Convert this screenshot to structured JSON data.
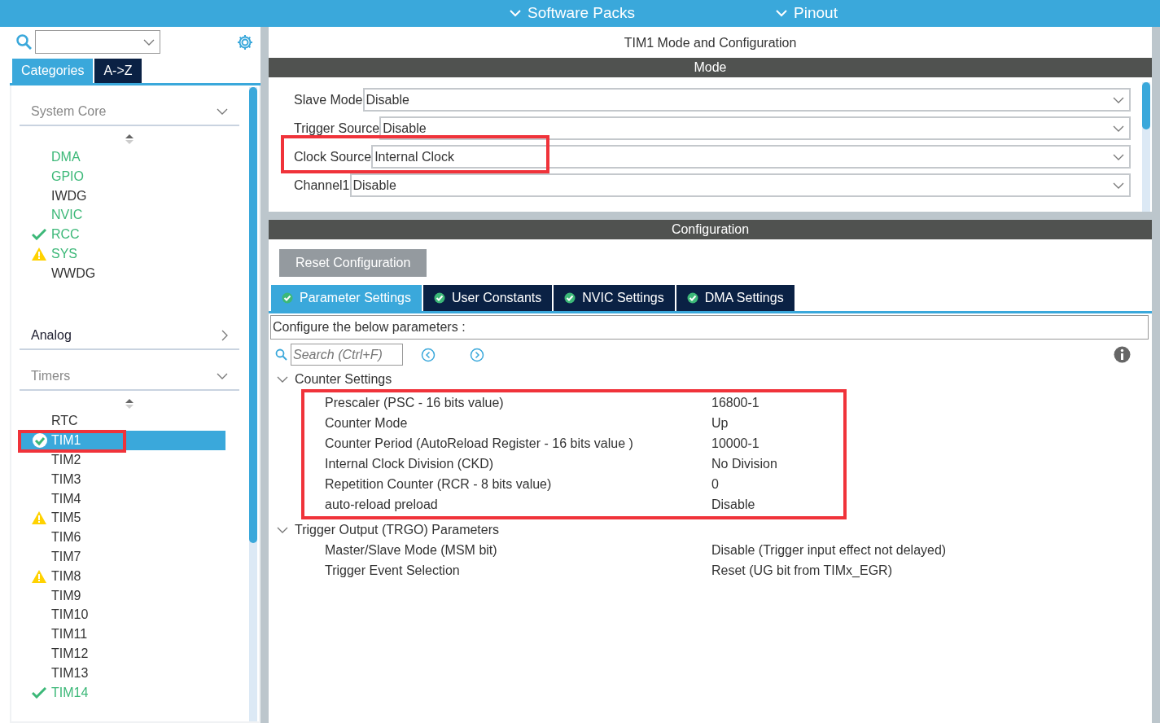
{
  "top_bar": {
    "menus": [
      {
        "label": "Software Packs"
      },
      {
        "label": "Pinout"
      }
    ]
  },
  "sidebar": {
    "tabs": [
      {
        "label": "Categories",
        "selected": true
      },
      {
        "label": "A->Z",
        "selected": false
      }
    ],
    "categories": [
      {
        "label": "System Core",
        "expanded": true,
        "items": [
          {
            "label": "DMA",
            "enabled": true,
            "kind": "plain",
            "selected": false,
            "highlighted": false
          },
          {
            "label": "GPIO",
            "enabled": true,
            "kind": "plain",
            "selected": false,
            "highlighted": false
          },
          {
            "label": "IWDG",
            "enabled": false,
            "kind": "plain",
            "selected": false,
            "highlighted": false
          },
          {
            "label": "NVIC",
            "enabled": true,
            "kind": "plain",
            "selected": false,
            "highlighted": false
          },
          {
            "label": "RCC",
            "enabled": true,
            "kind": "check",
            "selected": false,
            "highlighted": false
          },
          {
            "label": "SYS",
            "enabled": true,
            "kind": "warning",
            "selected": false,
            "highlighted": false
          },
          {
            "label": "WWDG",
            "enabled": false,
            "kind": "plain",
            "selected": false,
            "highlighted": false
          }
        ]
      },
      {
        "label": "Analog",
        "expanded": false
      },
      {
        "label": "Timers",
        "expanded": true,
        "items": [
          {
            "label": "RTC",
            "enabled": false,
            "kind": "plain",
            "selected": false,
            "highlighted": false
          },
          {
            "label": "TIM1",
            "enabled": true,
            "kind": "check",
            "selected": true,
            "highlighted": true
          },
          {
            "label": "TIM2",
            "enabled": false,
            "kind": "plain",
            "selected": false,
            "highlighted": false
          },
          {
            "label": "TIM3",
            "enabled": false,
            "kind": "plain",
            "selected": false,
            "highlighted": false
          },
          {
            "label": "TIM4",
            "enabled": false,
            "kind": "plain",
            "selected": false,
            "highlighted": false
          },
          {
            "label": "TIM5",
            "enabled": false,
            "kind": "warning",
            "selected": false,
            "highlighted": false
          },
          {
            "label": "TIM6",
            "enabled": false,
            "kind": "plain",
            "selected": false,
            "highlighted": false
          },
          {
            "label": "TIM7",
            "enabled": false,
            "kind": "plain",
            "selected": false,
            "highlighted": false
          },
          {
            "label": "TIM8",
            "enabled": false,
            "kind": "warning",
            "selected": false,
            "highlighted": false
          },
          {
            "label": "TIM9",
            "enabled": false,
            "kind": "plain",
            "selected": false,
            "highlighted": false
          },
          {
            "label": "TIM10",
            "enabled": false,
            "kind": "plain",
            "selected": false,
            "highlighted": false
          },
          {
            "label": "TIM11",
            "enabled": false,
            "kind": "plain",
            "selected": false,
            "highlighted": false
          },
          {
            "label": "TIM12",
            "enabled": false,
            "kind": "plain",
            "selected": false,
            "highlighted": false
          },
          {
            "label": "TIM13",
            "enabled": false,
            "kind": "plain",
            "selected": false,
            "highlighted": false
          },
          {
            "label": "TIM14",
            "enabled": true,
            "kind": "check",
            "selected": false,
            "highlighted": false
          }
        ]
      }
    ]
  },
  "main": {
    "title": "TIM1 Mode and Configuration",
    "mode": {
      "header": "Mode",
      "fields": [
        {
          "label": "Slave Mode",
          "value": "Disable",
          "highlighted": false
        },
        {
          "label": "Trigger Source",
          "value": "Disable",
          "highlighted": false
        },
        {
          "label": "Clock Source",
          "value": "Internal Clock",
          "highlighted": true
        },
        {
          "label": "Channel1",
          "value": "Disable",
          "highlighted": false
        }
      ]
    },
    "configuration": {
      "header": "Configuration",
      "reset_button": "Reset Configuration",
      "tabs": [
        {
          "label": "Parameter Settings",
          "selected": true
        },
        {
          "label": "User Constants",
          "selected": false
        },
        {
          "label": "NVIC Settings",
          "selected": false
        },
        {
          "label": "DMA Settings",
          "selected": false
        }
      ],
      "description": "Configure the below parameters :",
      "search": {
        "placeholder": "Search (Ctrl+F)"
      },
      "groups": [
        {
          "label": "Counter Settings",
          "expanded": true,
          "highlighted": true,
          "params": [
            {
              "name": "Prescaler (PSC - 16 bits value)",
              "value": "16800-1"
            },
            {
              "name": "Counter Mode",
              "value": "Up"
            },
            {
              "name": "Counter Period (AutoReload Register - 16 bits value )",
              "value": "10000-1"
            },
            {
              "name": "Internal Clock Division (CKD)",
              "value": "No Division"
            },
            {
              "name": "Repetition Counter (RCR - 8 bits value)",
              "value": "0"
            },
            {
              "name": "auto-reload preload",
              "value": "Disable"
            }
          ]
        },
        {
          "label": "Trigger Output (TRGO) Parameters",
          "expanded": true,
          "highlighted": false,
          "params": [
            {
              "name": "Master/Slave Mode (MSM bit)",
              "value": "Disable (Trigger input effect not delayed)"
            },
            {
              "name": "Trigger Event Selection",
              "value": "Reset (UG bit from TIMx_EGR)"
            }
          ]
        }
      ]
    }
  }
}
